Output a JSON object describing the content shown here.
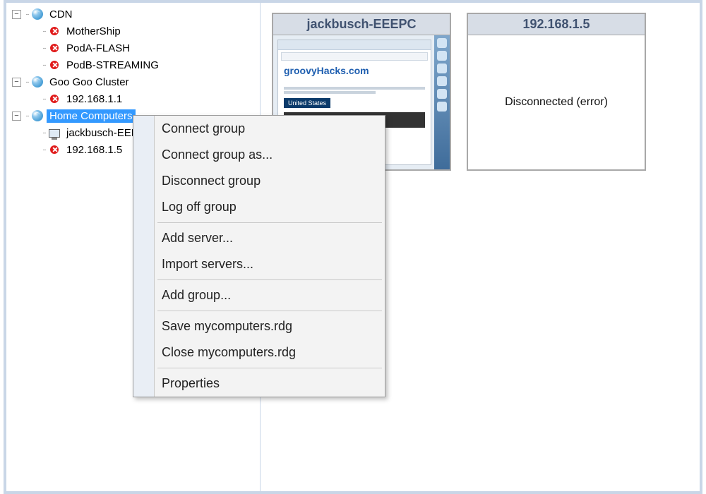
{
  "tree": {
    "groups": [
      {
        "label": "CDN",
        "expanded": true,
        "children": [
          {
            "label": "MotherShip",
            "status": "error"
          },
          {
            "label": "PodA-FLASH",
            "status": "error"
          },
          {
            "label": "PodB-STREAMING",
            "status": "error"
          }
        ]
      },
      {
        "label": "Goo Goo Cluster",
        "expanded": true,
        "children": [
          {
            "label": "192.168.1.1",
            "status": "error"
          }
        ]
      },
      {
        "label": "Home Computers",
        "expanded": true,
        "selected": true,
        "children": [
          {
            "label": "jackbusch-EEEPC",
            "status": "connected"
          },
          {
            "label": "192.168.1.5",
            "status": "error"
          }
        ]
      }
    ]
  },
  "thumbnails": [
    {
      "title": "jackbusch-EEEPC",
      "kind": "screenshot",
      "screenshot": {
        "site_title": "groovyHacks.com",
        "badge": "United States"
      }
    },
    {
      "title": "192.168.1.5",
      "kind": "message",
      "message": "Disconnected (error)"
    }
  ],
  "context_menu": {
    "items": [
      "Connect group",
      "Connect group as...",
      "Disconnect group",
      "Log off group",
      "---",
      "Add server...",
      "Import servers...",
      "---",
      "Add group...",
      "---",
      "Save mycomputers.rdg",
      "Close mycomputers.rdg",
      "---",
      "Properties"
    ]
  }
}
